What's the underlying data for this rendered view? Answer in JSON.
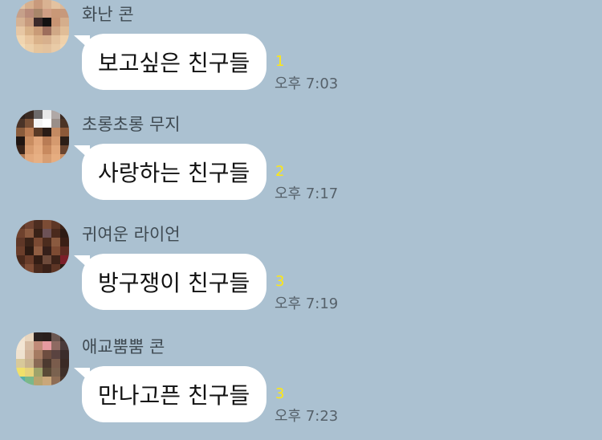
{
  "colors": {
    "background": "#abc1d1",
    "bubble": "#ffffff",
    "unread": "#ffe812",
    "time": "#56616a",
    "sender": "#3f4a52"
  },
  "messages": [
    {
      "sender": "화난 콘",
      "text": "보고싶은 친구들",
      "unread": "1",
      "time": "오후 7:03",
      "avatar_icon": "pixelated-avatar-icon"
    },
    {
      "sender": "초롱초롱 무지",
      "text": "사랑하는 친구들",
      "unread": "2",
      "time": "오후 7:17",
      "avatar_icon": "pixelated-avatar-icon"
    },
    {
      "sender": "귀여운 라이언",
      "text": "방구쟁이 친구들",
      "unread": "3",
      "time": "오후 7:19",
      "avatar_icon": "pixelated-avatar-icon"
    },
    {
      "sender": "애교뿜뿜 콘",
      "text": "만나고픈 친구들",
      "unread": "3",
      "time": "오후 7:23",
      "avatar_icon": "pixelated-avatar-icon"
    }
  ]
}
